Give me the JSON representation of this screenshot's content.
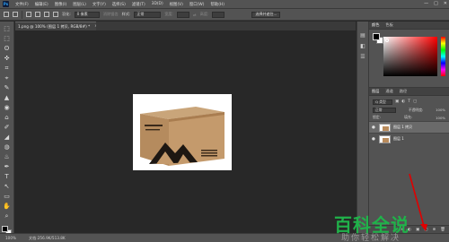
{
  "menubar": {
    "logo": "Ps",
    "items": [
      "文件(F)",
      "编辑(E)",
      "图像(I)",
      "图层(L)",
      "文字(Y)",
      "选择(S)",
      "滤镜(T)",
      "3D(D)",
      "视图(V)",
      "窗口(W)",
      "帮助(H)"
    ],
    "window_controls": [
      "—",
      "□",
      "✕"
    ]
  },
  "options": {
    "feather_label": "羽化:",
    "feather_value": "0 像素",
    "antialias_label": "消除锯齿",
    "style_label": "样式:",
    "style_value": "正常",
    "width_label": "宽度:",
    "height_label": "高度:",
    "select_mask_button": "选择并遮住..."
  },
  "document_tab": {
    "title": "1.png @ 100% (图层 1 拷贝, RGB/8#) *",
    "close": "×"
  },
  "tools": [
    "⬚",
    "⬚",
    "ʘ",
    "✜",
    "⌗",
    "⌖",
    "✎",
    "▲",
    "◉",
    "⌂",
    "✐",
    "◢",
    "◍",
    "♨",
    "✒",
    "T",
    "↖",
    "▭",
    "✋",
    "⌕"
  ],
  "right_panel": {
    "color_tabs": [
      "颜色",
      "色板"
    ],
    "layers_tabs": [
      "图层",
      "通道",
      "路径"
    ],
    "kind_filter": "Q 类型",
    "blend_mode": "正常",
    "opacity_label": "不透明度:",
    "opacity_value": "100%",
    "lock_label": "锁定:",
    "fill_label": "填充:",
    "fill_value": "100%",
    "layers": [
      {
        "name": "图层 1 拷贝",
        "selected": true
      },
      {
        "name": "图层 1",
        "selected": false
      }
    ],
    "footer_icons": [
      "fx",
      "◐",
      "▣",
      "▢",
      "⊕",
      "🗑"
    ]
  },
  "status": {
    "zoom": "100%",
    "doc_info": "文档:256.9K/513.8K"
  },
  "watermark": {
    "title": "百科全说",
    "subtitle": "助你轻松解决"
  },
  "colors": {
    "ui_dark": "#535353",
    "canvas_bg": "#282828",
    "accent_red": "#e00000",
    "watermark_green": "#20b24a"
  }
}
